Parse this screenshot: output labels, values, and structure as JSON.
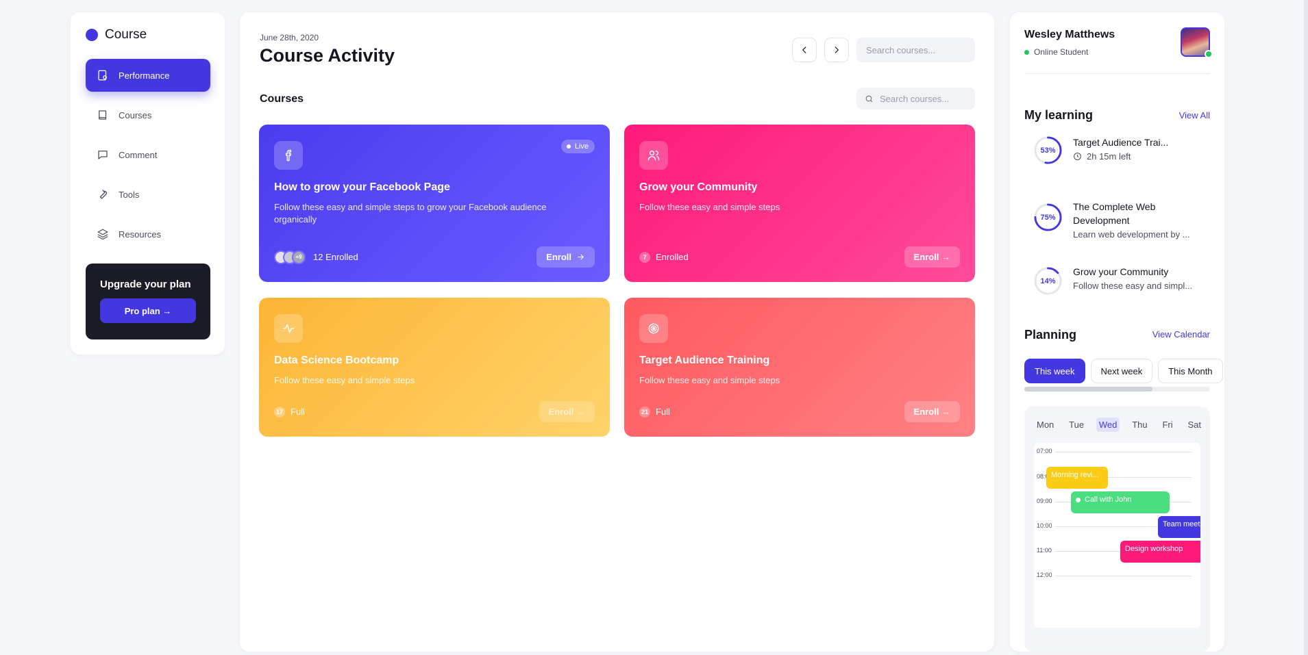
{
  "sidebar": {
    "brand": "Course",
    "items": [
      {
        "label": "Performance",
        "icon": "performance-icon"
      },
      {
        "label": "Courses",
        "icon": "book-icon"
      },
      {
        "label": "Comment",
        "icon": "comment-icon"
      },
      {
        "label": "Tools",
        "icon": "wrench-icon"
      },
      {
        "label": "Resources",
        "icon": "layers-icon"
      }
    ],
    "upgrade": {
      "title": "Upgrade your plan",
      "button": "Pro plan →"
    }
  },
  "main": {
    "date": "June 28th, 2020",
    "title": "Course Activity",
    "search_placeholder": "Search courses...",
    "section_title": "Courses",
    "courses_search_placeholder": "Search courses...",
    "cards": [
      {
        "title": "How to grow your Facebook Page",
        "desc": "Follow these easy and simple steps to grow your Facebook audience organically",
        "badge": "Live",
        "avatar_more": "+9",
        "enrolled": "12 Enrolled",
        "button": "Enroll",
        "icon": "facebook-icon",
        "color": "#4a3cf0"
      },
      {
        "title": "Grow your Community",
        "desc": "Follow these easy and simple steps",
        "count": "7",
        "enrolled": "Enrolled",
        "button": "Enroll →",
        "icon": "users-icon",
        "color": "#ff1a7a"
      },
      {
        "title": "Data Science Bootcamp",
        "desc": "Follow these easy and simple steps",
        "count": "17",
        "enrolled": "Full",
        "button": "Enroll →",
        "icon": "activity-icon",
        "color": "#fdb535"
      },
      {
        "title": "Target Audience Training",
        "desc": "Follow these easy and simple steps",
        "count": "21",
        "enrolled": "Full",
        "button": "Enroll →",
        "icon": "target-icon",
        "color": "#ff5a5f"
      }
    ]
  },
  "right": {
    "name": "Wesley Matthews",
    "status": "Online Student",
    "my_learning": "My learning",
    "view_all": "View All",
    "learning": [
      {
        "percent": "53%",
        "progress": 0.53,
        "title": "Target Audience Trai...",
        "sub": "2h 15m left"
      },
      {
        "percent": "75%",
        "progress": 0.75,
        "title": "The Complete Web Development",
        "sub": "Learn web development by ..."
      },
      {
        "percent": "14%",
        "progress": 0.14,
        "title": "Grow your Community",
        "sub": "Follow these easy and simpl..."
      }
    ],
    "planning": "Planning",
    "view_calendar": "View Calendar",
    "tabs": [
      "This week",
      "Next week",
      "This Month"
    ],
    "tab_progress": 0.69,
    "days": [
      "Mon",
      "Tue",
      "Wed",
      "Thu",
      "Fri",
      "Sat"
    ],
    "today": "Wed",
    "times": [
      "07:00",
      "08:00",
      "09:00",
      "10:00",
      "11:00",
      "12:00"
    ],
    "events": [
      {
        "label": "Morning revi...",
        "color": "#facc15"
      },
      {
        "label": "Call with John",
        "color": "#4ade80"
      },
      {
        "label": "Team meet",
        "color": "#4338e0"
      },
      {
        "label": "Design workshop",
        "color": "#ff1a7a"
      }
    ]
  }
}
